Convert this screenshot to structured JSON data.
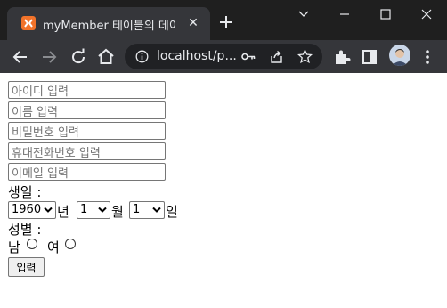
{
  "browser": {
    "tab_title": "myMember 테이블의 데이터",
    "url": "localhost/p...",
    "tab_close": "✕",
    "new_tab": "+"
  },
  "form": {
    "id_placeholder": "아이디 입력",
    "name_placeholder": "이름 입력",
    "password_placeholder": "비밀번호 입력",
    "phone_placeholder": "휴대전화번호 입력",
    "email_placeholder": "이메일 입력",
    "birthday_label": "생일 :",
    "year_value": "1960",
    "year_suffix": "년",
    "month_value": "1",
    "month_suffix": "월",
    "day_value": "1",
    "day_suffix": "일",
    "gender_label": "성별 :",
    "male_label": "남",
    "female_label": "여",
    "submit_label": "입력"
  },
  "colors": {
    "titlebar": "#1f1f1f",
    "toolbar": "#35363a",
    "omnibox": "#202124",
    "favicon": "#f2732a"
  }
}
